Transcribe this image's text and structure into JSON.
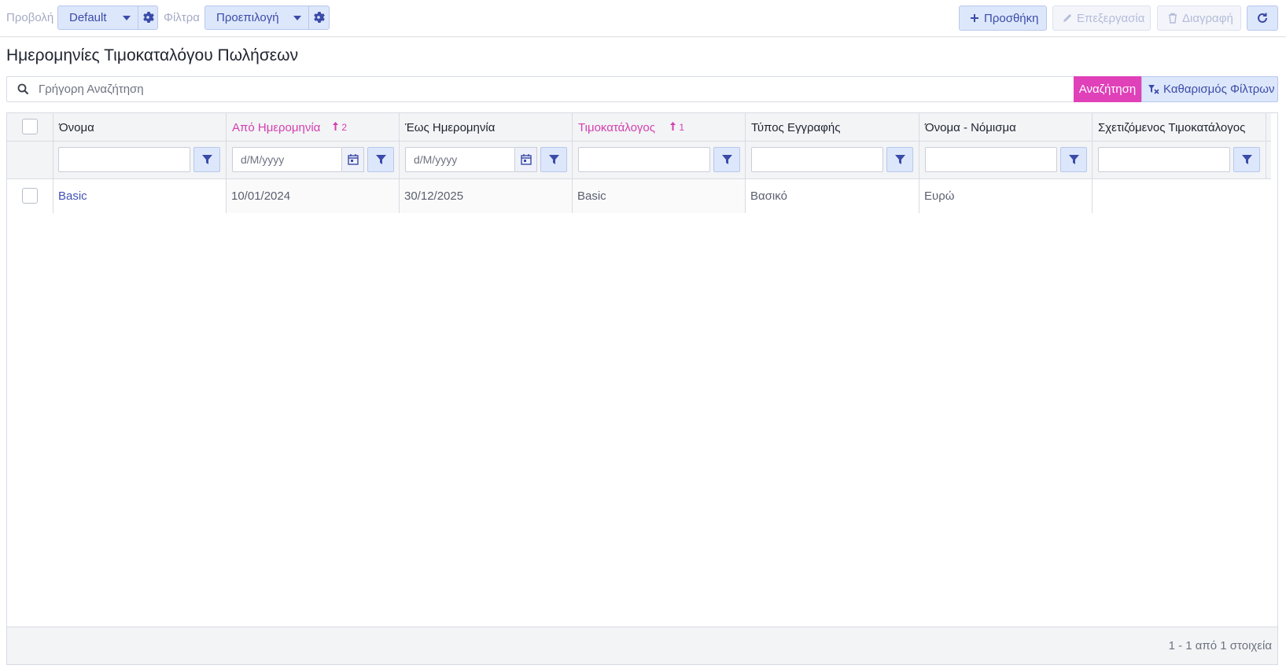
{
  "toolbar": {
    "view_label": "Προβολή",
    "view_value": "Default",
    "filters_label": "Φίλτρα",
    "filters_value": "Προεπιλογή",
    "add_label": "Προσθήκη",
    "edit_label": "Επεξεργασία",
    "delete_label": "Διαγραφή"
  },
  "page": {
    "title": "Ημερομηνίες Τιμοκαταλόγου Πωλήσεων"
  },
  "search": {
    "placeholder": "Γρήγορη Αναζήτηση",
    "search_button": "Αναζήτηση",
    "clear_button": "Καθαρισμός Φίλτρων"
  },
  "grid": {
    "columns": [
      {
        "label": "Όνομα"
      },
      {
        "label": "Από Ημερομηνία",
        "sort": "2"
      },
      {
        "label": "Έως Ημερομηνία"
      },
      {
        "label": "Τιμοκατάλογος",
        "sort": "1"
      },
      {
        "label": "Τύπος Εγγραφής"
      },
      {
        "label": "Όνομα - Νόμισμα"
      },
      {
        "label": "Σχετιζόμενος Τιμοκατάλογος"
      }
    ],
    "date_placeholder": "d/M/yyyy",
    "rows": [
      {
        "name": "Basic",
        "from": "10/01/2024",
        "to": "30/12/2025",
        "pricelist": "Basic",
        "type": "Βασικό",
        "currency": "Ευρώ",
        "related": ""
      }
    ],
    "pager": "1 - 1 από 1 στοιχεία"
  },
  "colors": {
    "accent": "#e040b8",
    "primary": "#3b4ba8",
    "button_bg": "#dde7fb"
  }
}
